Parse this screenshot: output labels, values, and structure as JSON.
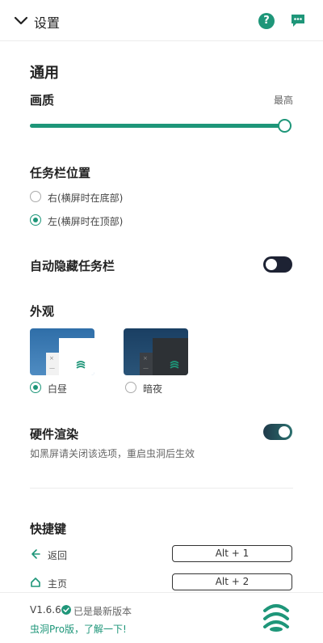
{
  "header": {
    "title": "设置",
    "help_icon": "question-icon",
    "chat_icon": "chat-bubble-icon"
  },
  "general": {
    "title": "通用",
    "quality": {
      "label": "画质",
      "value_label": "最高",
      "level": 1.0
    }
  },
  "taskbar_position": {
    "title": "任务栏位置",
    "options": [
      {
        "label": "右(横屏时在底部)",
        "checked": false
      },
      {
        "label": "左(横屏时在顶部)",
        "checked": true
      }
    ]
  },
  "auto_hide": {
    "label": "自动隐藏任务栏",
    "enabled": false
  },
  "appearance": {
    "title": "外观",
    "themes": [
      {
        "label": "白昼",
        "checked": true
      },
      {
        "label": "暗夜",
        "checked": false
      }
    ],
    "preview_x": "×",
    "preview_dash": "—"
  },
  "hw_render": {
    "label": "硬件渲染",
    "description": "如黑屏请关闭该选项，重启虫洞后生效",
    "enabled": true
  },
  "shortcuts": {
    "title": "快捷键",
    "items": [
      {
        "label": "返回",
        "key": "Alt + 1",
        "icon": "back-arrow-icon"
      },
      {
        "label": "主页",
        "key": "Alt + 2",
        "icon": "home-icon"
      }
    ]
  },
  "footer": {
    "version": "V1.6.6",
    "status": "已是最新版本",
    "pro_link": "虫洞Pro版，了解一下!"
  },
  "colors": {
    "accent": "#1e9679",
    "toggle_dark": "#1d2233"
  }
}
